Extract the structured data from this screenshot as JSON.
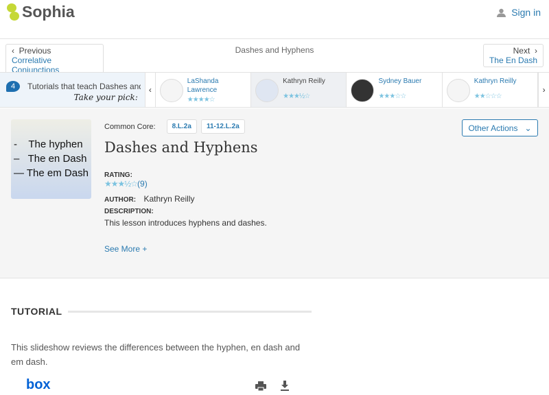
{
  "header": {
    "logo": "Sophia",
    "signin": "Sign in"
  },
  "nav": {
    "previous_label": "Previous",
    "previous_title": "Correlative Conjunctions",
    "current": "Dashes and Hyphens",
    "next_label": "Next",
    "next_title": "The En Dash"
  },
  "carousel": {
    "count": "4",
    "intro": "Tutorials that teach Dashes and Hyphens",
    "pick": "Take your pick:",
    "items": [
      {
        "author": "LaShanda Lawrence",
        "rating": 4,
        "stars": "★★★★☆"
      },
      {
        "author": "Kathryn Reilly",
        "rating": 3.5,
        "stars": "★★★½☆"
      },
      {
        "author": "Sydney Bauer",
        "rating": 3,
        "stars": "★★★☆☆"
      },
      {
        "author": "Kathryn Reilly",
        "rating": 2,
        "stars": "★★☆☆☆"
      }
    ]
  },
  "lesson": {
    "cover_text": "-    The hyphen\n–   The en Dash\n— The em Dash",
    "common_core_label": "Common Core:",
    "standards": [
      "8.L.2a",
      "11-12.L.2a"
    ],
    "title": "Dashes and Hyphens",
    "rating_label": "RATING:",
    "rating": 3.5,
    "rating_stars": "★★★½☆",
    "rating_count": "(9)",
    "author_label": "AUTHOR:",
    "author": "Kathryn Reilly",
    "description_label": "DESCRIPTION:",
    "description": "This lesson introduces hyphens and dashes.",
    "see_more": "See More +",
    "other_actions": "Other Actions"
  },
  "tutorial": {
    "heading": "TUTORIAL",
    "description": "This slideshow reviews the differences between the hyphen, en dash and em dash.",
    "viewer_logo": "box"
  },
  "colors": {
    "accent": "#2a7ab0",
    "brand": "#c5d836",
    "stars": "#7cc3e0"
  }
}
